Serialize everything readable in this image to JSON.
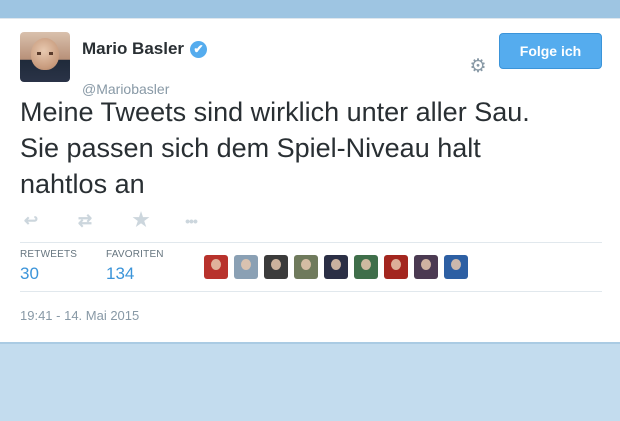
{
  "user": {
    "name": "Mario Basler",
    "handle": "@Mariobasler",
    "verified_glyph": "✔"
  },
  "follow_button": {
    "label": "Folge ich"
  },
  "settings_icon": "gear-icon",
  "tweet": {
    "lines": [
      "Meine Tweets sind wirklich unter aller Sau.",
      "Sie passen sich dem Spiel-Niveau halt",
      "nahtlos an"
    ]
  },
  "actions": {
    "reply_icon": "↩",
    "retweet_icon": "⇄",
    "favorite_icon": "★",
    "more_icon": "•••"
  },
  "stats": {
    "retweets_label": "RETWEETS",
    "retweets_count": "30",
    "favorites_label": "FAVORITEN",
    "favorites_count": "134"
  },
  "favoriter_avatar_colors": [
    "#b8322c",
    "#8aa0b4",
    "#3b3b3b",
    "#6f7a5c",
    "#2b2f45",
    "#3f6e4a",
    "#a3261f",
    "#4b3a52",
    "#2d5fa3"
  ],
  "timestamp": "19:41 - 14. Mai 2015",
  "colors": {
    "accent": "#55acee",
    "link": "#3b94d9",
    "text": "#292f33",
    "muted": "#8899a6",
    "background": "#c3dcee"
  }
}
